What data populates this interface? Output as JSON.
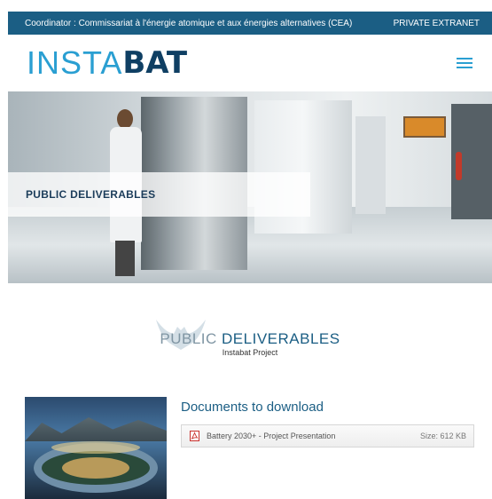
{
  "topbar": {
    "coordinator": "Coordinator : Commissariat à l'énergie atomique et aux énergies alternatives (CEA)",
    "extranet_link": "PRIVATE EXTRANET",
    "bg_color": "#1b5e84"
  },
  "header": {
    "logo_light": "INSTA",
    "logo_bold": "BAT",
    "menu_icon": "hamburger-menu-icon"
  },
  "hero": {
    "title": "PUBLIC DELIVERABLES"
  },
  "section": {
    "title_light": "PUBLIC ",
    "title_strong": "DELIVERABLES",
    "subtitle": "Instabat Project",
    "watermark_icon": "bat-icon"
  },
  "documents": {
    "heading": "Documents to download",
    "items": [
      {
        "name": "Battery 2030+ - Project Presentation",
        "size": "Size: 612 KB",
        "icon": "pdf-icon"
      }
    ]
  },
  "colors": {
    "accent": "#2a9fd2",
    "brand_dark": "#0f3f63",
    "heading_blue": "#1b5e84"
  }
}
